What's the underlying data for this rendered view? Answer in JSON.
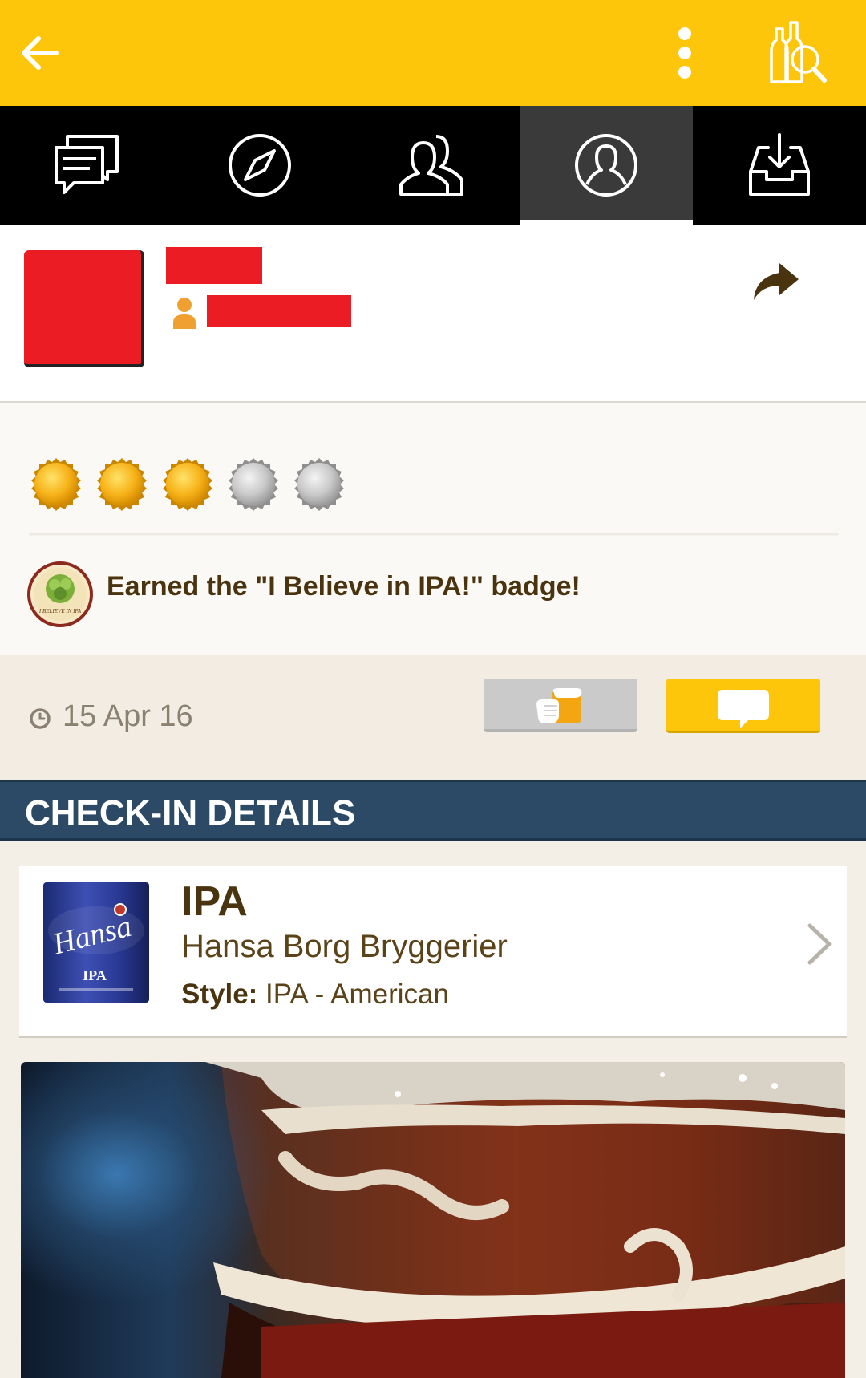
{
  "topbar": {
    "back_icon": "arrow-left-icon",
    "menu_icon": "more-vertical-icon",
    "search_icon": "beer-search-icon",
    "background": "#fdc60a"
  },
  "tabs": [
    {
      "icon": "chat-bubbles-icon",
      "active": false
    },
    {
      "icon": "compass-icon",
      "active": false
    },
    {
      "icon": "friends-icon",
      "active": false
    },
    {
      "icon": "profile-icon",
      "active": true
    },
    {
      "icon": "inbox-download-icon",
      "active": false
    }
  ],
  "rating": {
    "value": 3,
    "max": 5
  },
  "badge": {
    "text": "Earned the \"I Believe in IPA!\" badge!",
    "image_text": "I BELIEVE IN IPA"
  },
  "checkin": {
    "date": "15 Apr 16"
  },
  "section": {
    "title": "CHECK-IN DETAILS",
    "color": "#2c4a65"
  },
  "beer": {
    "name": "IPA",
    "brewery": "Hansa Borg Bryggerier",
    "style_label": "Style:",
    "style_value": "IPA - American",
    "can_brand": "Hansa",
    "can_text": "IPA"
  }
}
